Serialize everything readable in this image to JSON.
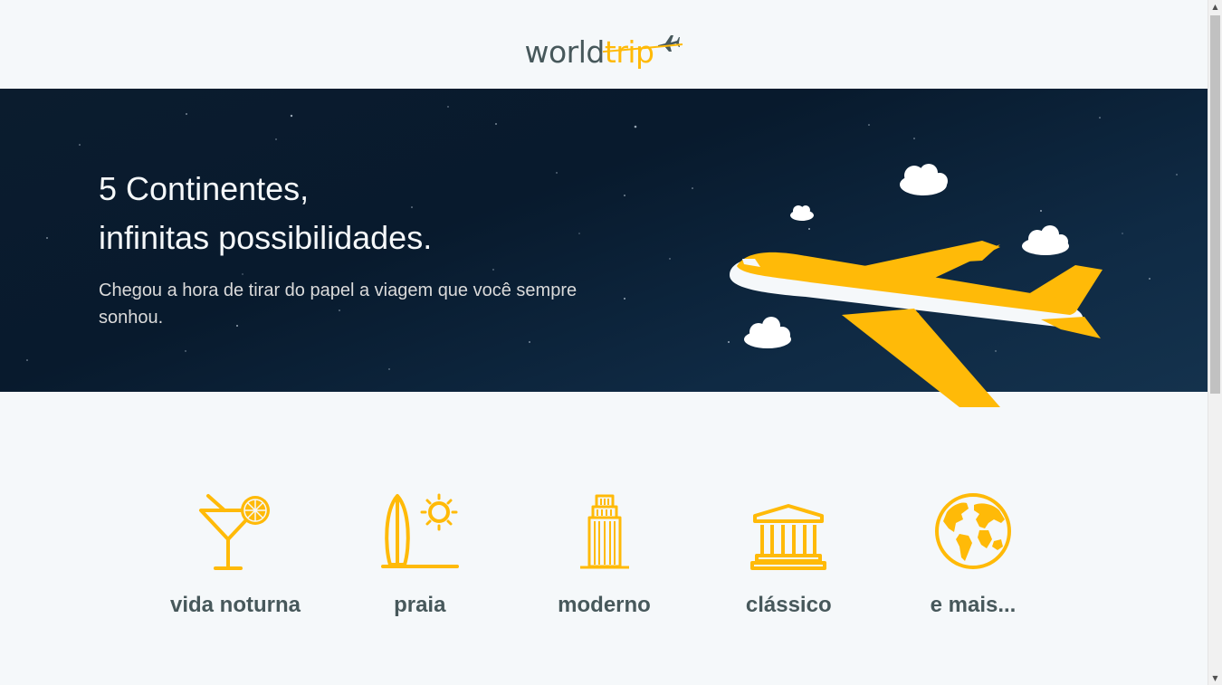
{
  "header": {
    "logo_world": "world",
    "logo_trip": "trip",
    "plane_icon": "airplane-icon"
  },
  "hero": {
    "title_line1": "5 Continentes,",
    "title_line2": "infinitas possibilidades.",
    "subtitle": "Chegou a hora de tirar do papel a viagem que você sempre sonhou.",
    "illustration": "airplane-with-clouds"
  },
  "categories": [
    {
      "label": "vida noturna",
      "icon": "cocktail-icon"
    },
    {
      "label": "praia",
      "icon": "surfboard-sun-icon"
    },
    {
      "label": "moderno",
      "icon": "skyscraper-icon"
    },
    {
      "label": "clássico",
      "icon": "museum-icon"
    },
    {
      "label": "e mais...",
      "icon": "globe-icon"
    }
  ],
  "colors": {
    "accent": "#FFBA08",
    "text_dark": "#47585B",
    "background": "#F5F8FA",
    "hero_bg": "#0B1C2E"
  }
}
